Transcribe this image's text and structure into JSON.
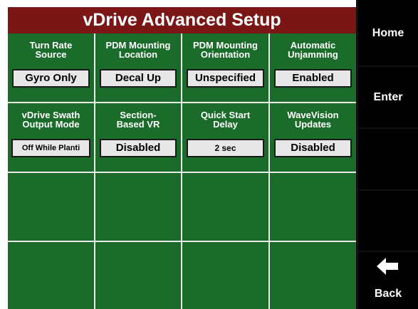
{
  "title": "vDrive Advanced Setup",
  "settings": [
    {
      "label_line1": "Turn Rate",
      "label_line2": "Source",
      "value": "Gyro Only"
    },
    {
      "label_line1": "PDM Mounting",
      "label_line2": "Location",
      "value": "Decal Up"
    },
    {
      "label_line1": "PDM Mounting",
      "label_line2": "Orientation",
      "value": "Unspecified"
    },
    {
      "label_line1": "Automatic",
      "label_line2": "Unjamming",
      "value": "Enabled"
    },
    {
      "label_line1": "vDrive Swath",
      "label_line2": "Output Mode",
      "value": "Off While Planti"
    },
    {
      "label_line1": "Section-",
      "label_line2": "Based VR",
      "value": "Disabled"
    },
    {
      "label_line1": "Quick Start",
      "label_line2": "Delay",
      "value": "2 sec"
    },
    {
      "label_line1": "WaveVision",
      "label_line2": "Updates",
      "value": "Disabled"
    }
  ],
  "menu": {
    "home": "Home",
    "enter": "Enter",
    "back": "Back",
    "back_icon": "arrow-left-icon"
  },
  "colors": {
    "title_bg": "#7a1616",
    "grid_bg": "#1b6b2a",
    "menu_bg": "#000000"
  }
}
